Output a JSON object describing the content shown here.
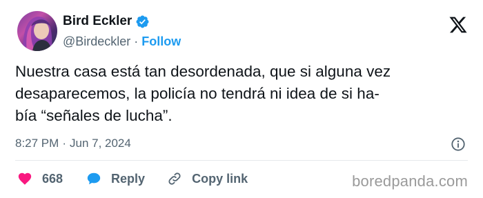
{
  "author": {
    "name": "Bird Eckler",
    "handle": "@Birdeckler",
    "separator": "·",
    "follow_label": "Follow"
  },
  "tweet": {
    "lines": [
      "Nuestra casa está tan desordenada, que si alguna vez",
      "desaparecemos, la policía no tendrá ni idea de si ha-",
      "bía “señales de lucha”."
    ],
    "time": "8:27 PM",
    "date": "Jun 7, 2024",
    "separator": "·"
  },
  "actions": {
    "likes": "668",
    "reply_label": "Reply",
    "copy_label": "Copy link"
  },
  "watermark": "boredpanda.com",
  "colors": {
    "accent": "#1d9bf0",
    "like": "#f91880",
    "muted": "#536471",
    "text": "#0f1419"
  },
  "icons": [
    "verified-badge-icon",
    "x-logo-icon",
    "info-icon",
    "heart-icon",
    "speech-bubble-icon",
    "link-icon"
  ]
}
